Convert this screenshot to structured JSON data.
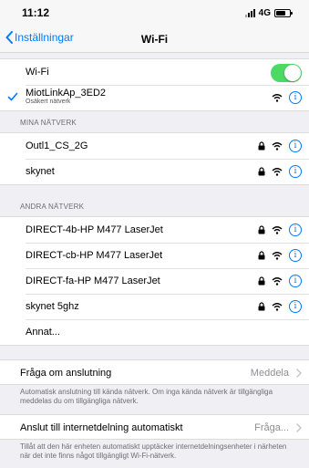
{
  "status_bar": {
    "time": "11:12",
    "network": "4G"
  },
  "nav": {
    "back_label": "Inställningar",
    "title": "Wi-Fi"
  },
  "wifi_toggle": {
    "label": "Wi-Fi",
    "on": true
  },
  "connected": {
    "name": "MiotLinkAp_3ED2",
    "subtitle": "Osäkert nätverk"
  },
  "my_networks": {
    "header": "MINA NÄTVERK",
    "items": [
      {
        "name": "Outl1_CS_2G"
      },
      {
        "name": "skynet"
      }
    ]
  },
  "other_networks": {
    "header": "ANDRA NÄTVERK",
    "items": [
      {
        "name": "DIRECT-4b-HP M477 LaserJet"
      },
      {
        "name": "DIRECT-cb-HP M477 LaserJet"
      },
      {
        "name": "DIRECT-fa-HP M477 LaserJet"
      },
      {
        "name": "skynet 5ghz"
      }
    ],
    "other_label": "Annat..."
  },
  "ask_to_join": {
    "label": "Fråga om anslutning",
    "value": "Meddela",
    "footer": "Automatisk anslutning till kända nätverk. Om inga kända nätverk är tillgängliga meddelas du om tillgängliga nätverk."
  },
  "auto_hotspot": {
    "label": "Anslut till internetdelning automatiskt",
    "value": "Fråga...",
    "footer": "Tillåt att den här enheten automatiskt upptäcker internetdelningsenheter i närheten när det inte finns något tillgängligt Wi-Fi-nätverk."
  },
  "colors": {
    "accent": "#007aff",
    "toggle_on": "#4cd964",
    "background": "#efeff4"
  },
  "icons": [
    "chevron-left-icon",
    "checkmark-icon",
    "lock-icon",
    "wifi-icon",
    "info-icon",
    "chevron-right-icon"
  ]
}
